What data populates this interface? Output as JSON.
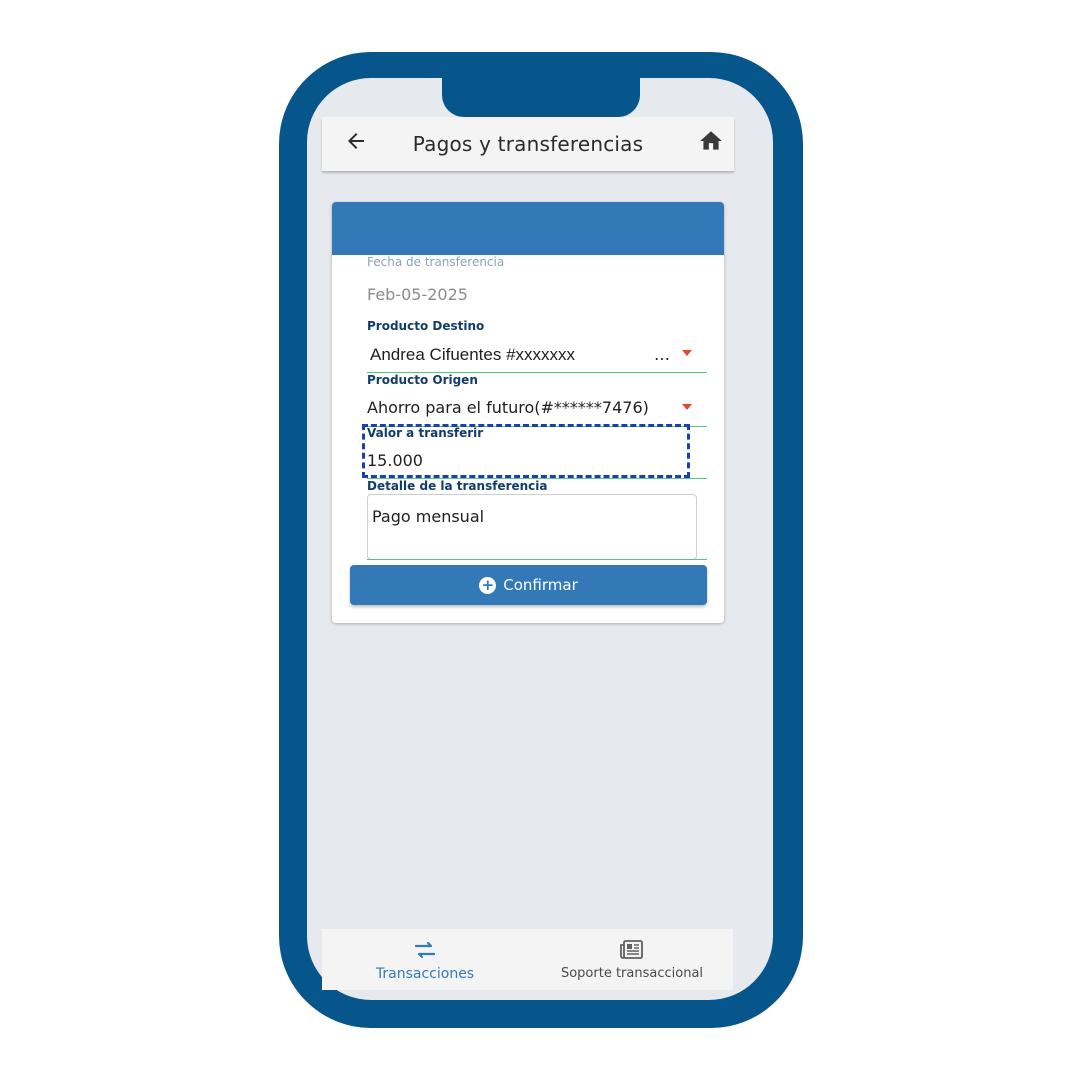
{
  "header": {
    "title": "Pagos y transferencias",
    "back_icon": "arrow-left-icon",
    "home_icon": "home-icon"
  },
  "form": {
    "fecha": {
      "label": "Fecha de transferencia",
      "value": "Feb-05-2025"
    },
    "destino": {
      "label": "Producto Destino",
      "value": "Andrea Cifuentes #xxxxxxx",
      "ellipsis": "…"
    },
    "origen": {
      "label": "Producto Origen",
      "value": "Ahorro para el futuro(#******7476)"
    },
    "valor": {
      "label": "Valor a transferir",
      "value": "15.000"
    },
    "detalle": {
      "label": "Detalle de la transferencia",
      "value": "Pago mensual"
    },
    "confirm_label": "Confirmar"
  },
  "bottom_nav": [
    {
      "label": "Transacciones",
      "icon": "swap-arrows-icon",
      "active": true
    },
    {
      "label": "Soporte transaccional",
      "icon": "newspaper-icon",
      "active": false
    }
  ],
  "colors": {
    "frame": "#06558b",
    "accent": "#3479b7",
    "label": "#123d6b",
    "underline": "#58c57a",
    "caret": "#e04b2e",
    "highlight": "#1a3fb0"
  }
}
